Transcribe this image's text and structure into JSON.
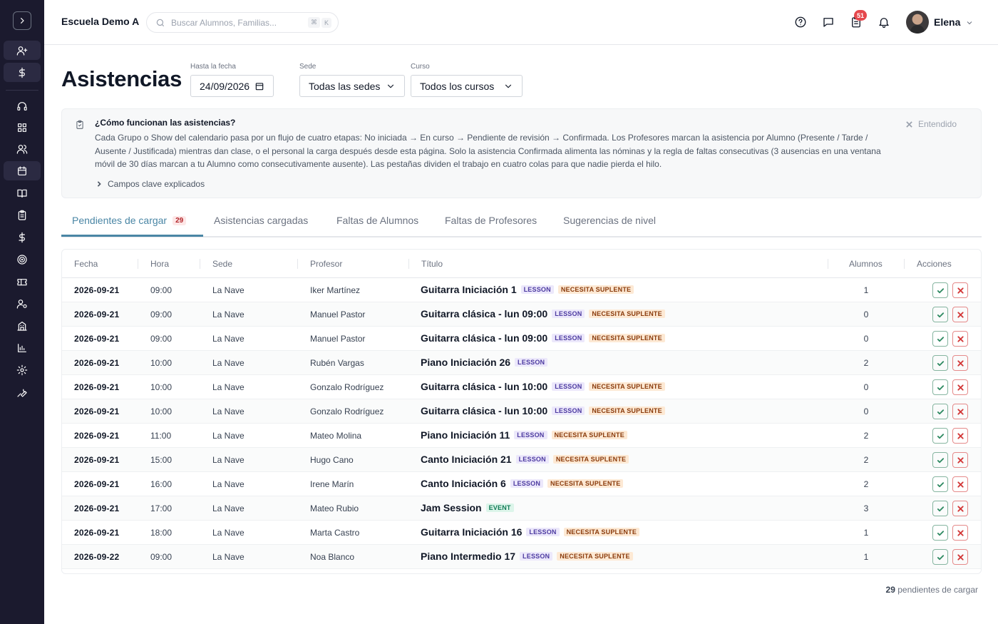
{
  "header": {
    "school_name": "Escuela Demo A",
    "search_placeholder": "Buscar Alumnos, Familias...",
    "search_shortcut": [
      "⌘",
      "K"
    ],
    "tasks_badge": "51",
    "user_name": "Elena"
  },
  "sidebar": {
    "items": [
      {
        "icon": "user-plus-icon"
      },
      {
        "icon": "dollar-icon"
      },
      {
        "icon": "headset-icon"
      },
      {
        "icon": "dashboard-grid-icon"
      },
      {
        "icon": "users-icon"
      },
      {
        "icon": "calendar-icon",
        "active": true
      },
      {
        "icon": "book-icon"
      },
      {
        "icon": "clipboard-icon"
      },
      {
        "icon": "dollar-icon"
      },
      {
        "icon": "target-icon"
      },
      {
        "icon": "ticket-icon"
      },
      {
        "icon": "user-settings-icon"
      },
      {
        "icon": "building-icon"
      },
      {
        "icon": "bar-chart-icon"
      },
      {
        "icon": "gear-icon"
      },
      {
        "icon": "wrench-icon"
      }
    ]
  },
  "page": {
    "title": "Asistencias",
    "filters": {
      "date_label": "Hasta la fecha",
      "date_value": "24/09/2026",
      "site_label": "Sede",
      "site_value": "Todas las sedes",
      "course_label": "Curso",
      "course_value": "Todos los cursos"
    }
  },
  "info": {
    "title": "¿Cómo funcionan las asistencias?",
    "body": "Cada Grupo o Show del calendario pasa por un flujo de cuatro etapas: No iniciada → En curso → Pendiente de revisión → Confirmada. Los Profesores marcan la asistencia por Alumno (Presente / Tarde / Ausente / Justificada) mientras dan clase, o el personal la carga después desde esta página. Solo la asistencia Confirmada alimenta las nóminas y la regla de faltas consecutivas (3 ausencias en una ventana móvil de 30 días marcan a tu Alumno como consecutivamente ausente). Las pestañas dividen el trabajo en cuatro colas para que nadie pierda el hilo.",
    "dismiss": "Entendido",
    "more": "Campos clave explicados"
  },
  "tabs": [
    {
      "label": "Pendientes de cargar",
      "badge": "29",
      "active": true
    },
    {
      "label": "Asistencias cargadas"
    },
    {
      "label": "Faltas de Alumnos"
    },
    {
      "label": "Faltas de Profesores"
    },
    {
      "label": "Sugerencias de nivel"
    }
  ],
  "table": {
    "columns": {
      "fecha": "Fecha",
      "hora": "Hora",
      "sede": "Sede",
      "profesor": "Profesor",
      "titulo": "Título",
      "alumnos": "Alumnos",
      "acciones": "Acciones"
    },
    "rows": [
      {
        "fecha": "2026-09-21",
        "hora": "09:00",
        "sede": "La Nave",
        "profesor": "Iker Martínez",
        "titulo": "Guitarra Iniciación 1",
        "tags": [
          "LESSON",
          "NECESITA SUPLENTE"
        ],
        "alumnos": "1"
      },
      {
        "fecha": "2026-09-21",
        "hora": "09:00",
        "sede": "La Nave",
        "profesor": "Manuel Pastor",
        "titulo": "Guitarra clásica - lun 09:00",
        "tags": [
          "LESSON",
          "NECESITA SUPLENTE"
        ],
        "alumnos": "0"
      },
      {
        "fecha": "2026-09-21",
        "hora": "09:00",
        "sede": "La Nave",
        "profesor": "Manuel Pastor",
        "titulo": "Guitarra clásica - lun 09:00",
        "tags": [
          "LESSON",
          "NECESITA SUPLENTE"
        ],
        "alumnos": "0"
      },
      {
        "fecha": "2026-09-21",
        "hora": "10:00",
        "sede": "La Nave",
        "profesor": "Rubén Vargas",
        "titulo": "Piano Iniciación 26",
        "tags": [
          "LESSON"
        ],
        "alumnos": "2"
      },
      {
        "fecha": "2026-09-21",
        "hora": "10:00",
        "sede": "La Nave",
        "profesor": "Gonzalo Rodríguez",
        "titulo": "Guitarra clásica - lun 10:00",
        "tags": [
          "LESSON",
          "NECESITA SUPLENTE"
        ],
        "alumnos": "0"
      },
      {
        "fecha": "2026-09-21",
        "hora": "10:00",
        "sede": "La Nave",
        "profesor": "Gonzalo Rodríguez",
        "titulo": "Guitarra clásica - lun 10:00",
        "tags": [
          "LESSON",
          "NECESITA SUPLENTE"
        ],
        "alumnos": "0"
      },
      {
        "fecha": "2026-09-21",
        "hora": "11:00",
        "sede": "La Nave",
        "profesor": "Mateo Molina",
        "titulo": "Piano Iniciación 11",
        "tags": [
          "LESSON",
          "NECESITA SUPLENTE"
        ],
        "alumnos": "2"
      },
      {
        "fecha": "2026-09-21",
        "hora": "15:00",
        "sede": "La Nave",
        "profesor": "Hugo Cano",
        "titulo": "Canto Iniciación 21",
        "tags": [
          "LESSON",
          "NECESITA SUPLENTE"
        ],
        "alumnos": "2"
      },
      {
        "fecha": "2026-09-21",
        "hora": "16:00",
        "sede": "La Nave",
        "profesor": "Irene Marín",
        "titulo": "Canto Iniciación 6",
        "tags": [
          "LESSON",
          "NECESITA SUPLENTE"
        ],
        "alumnos": "2"
      },
      {
        "fecha": "2026-09-21",
        "hora": "17:00",
        "sede": "La Nave",
        "profesor": "Mateo Rubio",
        "titulo": "Jam Session",
        "tags": [
          "EVENT"
        ],
        "alumnos": "3"
      },
      {
        "fecha": "2026-09-21",
        "hora": "18:00",
        "sede": "La Nave",
        "profesor": "Marta Castro",
        "titulo": "Guitarra Iniciación 16",
        "tags": [
          "LESSON",
          "NECESITA SUPLENTE"
        ],
        "alumnos": "1"
      },
      {
        "fecha": "2026-09-22",
        "hora": "09:00",
        "sede": "La Nave",
        "profesor": "Noa Blanco",
        "titulo": "Piano Intermedio 17",
        "tags": [
          "LESSON",
          "NECESITA SUPLENTE"
        ],
        "alumnos": "1"
      }
    ]
  },
  "footer": {
    "count": "29",
    "count_label": "pendientes de cargar"
  },
  "colors": {
    "sidebar_bg": "#1b1a2e",
    "accent": "#4a86a5",
    "badge_red": "#e5484d",
    "confirm_green": "#2f8a62",
    "reject_red": "#d33a3a"
  }
}
